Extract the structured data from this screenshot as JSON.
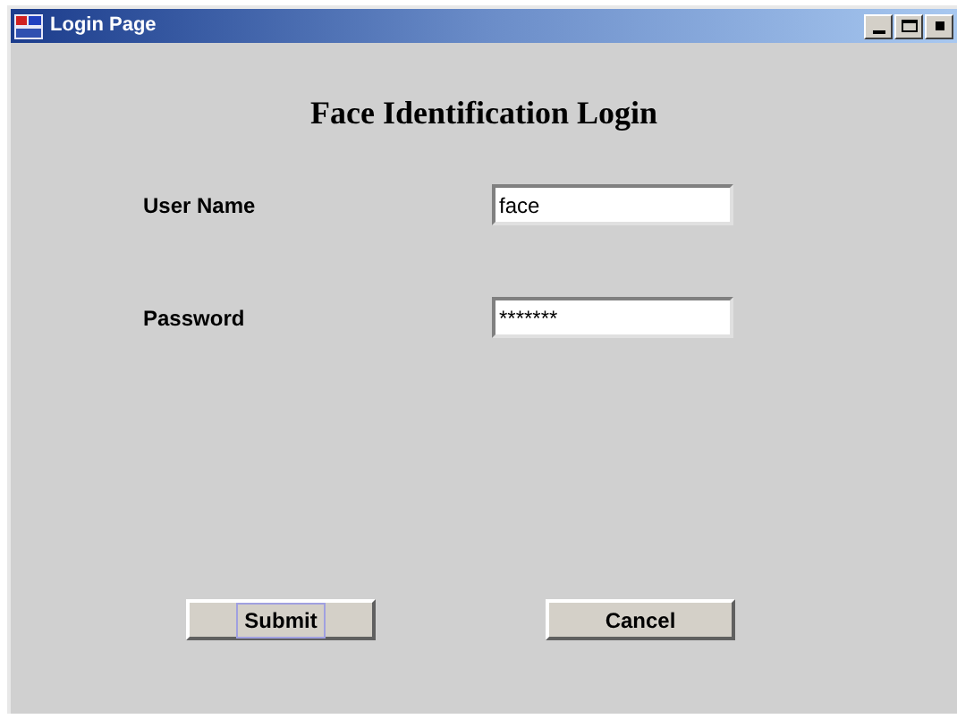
{
  "window": {
    "title": "Login Page"
  },
  "heading": "Face Identification Login",
  "fields": [
    {
      "label": "User Name",
      "value": "face"
    },
    {
      "label": "Password",
      "value": "*******"
    }
  ],
  "buttons": [
    {
      "label": "Submit",
      "focused": true
    },
    {
      "label": "Cancel",
      "focused": false
    }
  ]
}
